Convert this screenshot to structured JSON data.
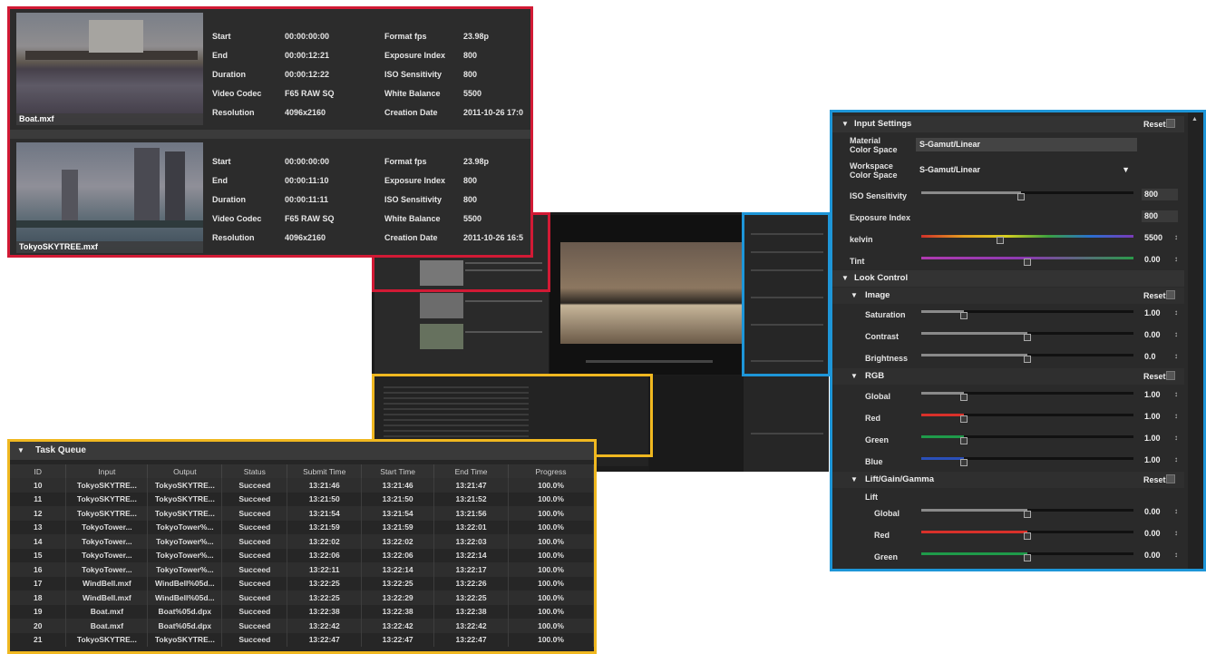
{
  "clips": [
    {
      "name": "Boat.mxf",
      "rows": [
        {
          "k1": "Start",
          "v1": "00:00:00:00",
          "k2": "Format fps",
          "v2": "23.98p"
        },
        {
          "k1": "End",
          "v1": "00:00:12:21",
          "k2": "Exposure Index",
          "v2": "800"
        },
        {
          "k1": "Duration",
          "v1": "00:00:12:22",
          "k2": "ISO Sensitivity",
          "v2": "800"
        },
        {
          "k1": "Video Codec",
          "v1": "F65 RAW SQ",
          "k2": "White Balance",
          "v2": "5500"
        },
        {
          "k1": "Resolution",
          "v1": "4096x2160",
          "k2": "Creation Date",
          "v2": "2011-10-26 17:0"
        }
      ]
    },
    {
      "name": "TokyoSKYTREE.mxf",
      "rows": [
        {
          "k1": "Start",
          "v1": "00:00:00:00",
          "k2": "Format fps",
          "v2": "23.98p"
        },
        {
          "k1": "End",
          "v1": "00:00:11:10",
          "k2": "Exposure Index",
          "v2": "800"
        },
        {
          "k1": "Duration",
          "v1": "00:00:11:11",
          "k2": "ISO Sensitivity",
          "v2": "800"
        },
        {
          "k1": "Video Codec",
          "v1": "F65 RAW SQ",
          "k2": "White Balance",
          "v2": "5500"
        },
        {
          "k1": "Resolution",
          "v1": "4096x2160",
          "k2": "Creation Date",
          "v2": "2011-10-26 16:5"
        }
      ]
    }
  ],
  "task_queue": {
    "title": "Task Queue",
    "columns": [
      "ID",
      "Input",
      "Output",
      "Status",
      "Submit Time",
      "Start Time",
      "End Time",
      "Progress"
    ],
    "rows": [
      [
        "10",
        "TokyoSKYTRE...",
        "TokyoSKYTRE...",
        "Succeed",
        "13:21:46",
        "13:21:46",
        "13:21:47",
        "100.0%"
      ],
      [
        "11",
        "TokyoSKYTRE...",
        "TokyoSKYTRE...",
        "Succeed",
        "13:21:50",
        "13:21:50",
        "13:21:52",
        "100.0%"
      ],
      [
        "12",
        "TokyoSKYTRE...",
        "TokyoSKYTRE...",
        "Succeed",
        "13:21:54",
        "13:21:54",
        "13:21:56",
        "100.0%"
      ],
      [
        "13",
        "TokyoTower...",
        "TokyoTower%...",
        "Succeed",
        "13:21:59",
        "13:21:59",
        "13:22:01",
        "100.0%"
      ],
      [
        "14",
        "TokyoTower...",
        "TokyoTower%...",
        "Succeed",
        "13:22:02",
        "13:22:02",
        "13:22:03",
        "100.0%"
      ],
      [
        "15",
        "TokyoTower...",
        "TokyoTower%...",
        "Succeed",
        "13:22:06",
        "13:22:06",
        "13:22:14",
        "100.0%"
      ],
      [
        "16",
        "TokyoTower...",
        "TokyoTower%...",
        "Succeed",
        "13:22:11",
        "13:22:14",
        "13:22:17",
        "100.0%"
      ],
      [
        "17",
        "WindBell.mxf",
        "WindBell%05d...",
        "Succeed",
        "13:22:25",
        "13:22:25",
        "13:22:26",
        "100.0%"
      ],
      [
        "18",
        "WindBell.mxf",
        "WindBell%05d...",
        "Succeed",
        "13:22:25",
        "13:22:29",
        "13:22:25",
        "100.0%"
      ],
      [
        "19",
        "Boat.mxf",
        "Boat%05d.dpx",
        "Succeed",
        "13:22:38",
        "13:22:38",
        "13:22:38",
        "100.0%"
      ],
      [
        "20",
        "Boat.mxf",
        "Boat%05d.dpx",
        "Succeed",
        "13:22:42",
        "13:22:42",
        "13:22:42",
        "100.0%"
      ],
      [
        "21",
        "TokyoSKYTRE...",
        "TokyoSKYTRE...",
        "Succeed",
        "13:22:47",
        "13:22:47",
        "13:22:47",
        "100.0%"
      ]
    ]
  },
  "settings": {
    "input_settings": "Input Settings",
    "reset": "Reset",
    "material_color_space_label": "Material\nColor Space",
    "material_color_space": "S-Gamut/Linear",
    "workspace_color_space_label": "Workspace\nColor Space",
    "workspace_color_space": "S-Gamut/Linear",
    "iso_label": "ISO Sensitivity",
    "iso_value": "800",
    "iso_level": 0.47,
    "ei_label": "Exposure Index",
    "ei_value": "800",
    "kelvin_label": "kelvin",
    "kelvin_value": "5500",
    "kelvin_level": 0.37,
    "tint_label": "Tint",
    "tint_value": "0.00",
    "tint_level": 0.5,
    "look_control": "Look Control",
    "image": "Image",
    "saturation_label": "Saturation",
    "saturation_value": "1.00",
    "saturation_level": 0.2,
    "contrast_label": "Contrast",
    "contrast_value": "0.00",
    "contrast_level": 0.5,
    "brightness_label": "Brightness",
    "brightness_value": "0.0",
    "brightness_level": 0.5,
    "rgb": "RGB",
    "rgb_global_label": "Global",
    "rgb_global_value": "1.00",
    "rgb_global_level": 0.2,
    "rgb_red_label": "Red",
    "rgb_red_value": "1.00",
    "rgb_red_level": 0.2,
    "rgb_green_label": "Green",
    "rgb_green_value": "1.00",
    "rgb_green_level": 0.2,
    "rgb_blue_label": "Blue",
    "rgb_blue_value": "1.00",
    "rgb_blue_level": 0.2,
    "lgg": "Lift/Gain/Gamma",
    "lift": "Lift",
    "lift_global_label": "Global",
    "lift_global_value": "0.00",
    "lift_global_level": 0.5,
    "lift_red_label": "Red",
    "lift_red_value": "0.00",
    "lift_red_level": 0.5,
    "lift_green_label": "Green",
    "lift_green_value": "0.00",
    "lift_green_level": 0.5
  },
  "colors": {
    "red_frame": "#d21a35",
    "blue_frame": "#1e96d8",
    "yellow_frame": "#f0b820",
    "slider_red": "#d8312a",
    "slider_green": "#1f9a4a",
    "slider_blue": "#2a4fb8"
  }
}
